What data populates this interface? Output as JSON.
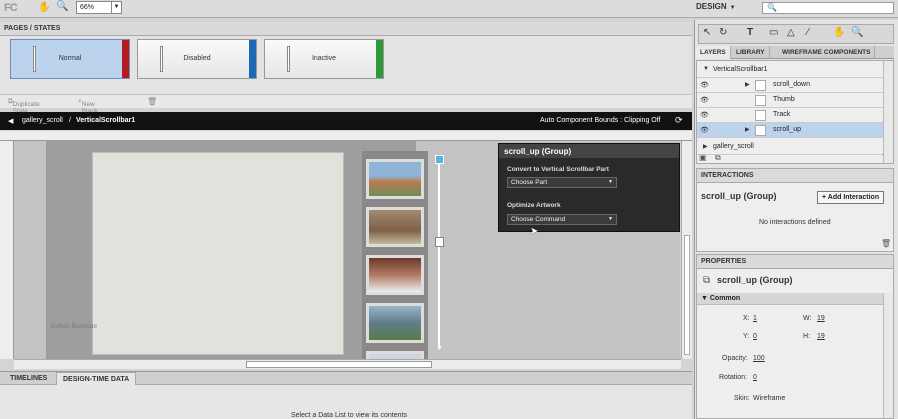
{
  "toolbar": {
    "logo": "FC",
    "zoom_value": "66%",
    "mode": "DESIGN",
    "hand_icon": "hand-icon",
    "zoom_icon": "magnifier-icon",
    "search_icon": "magnifier-icon"
  },
  "pages_states": {
    "header": "PAGES / STATES",
    "states": [
      {
        "label": "Normal",
        "color": "#b3191f"
      },
      {
        "label": "Disabled",
        "color": "#1e69b5"
      },
      {
        "label": "Inactive",
        "color": "#2f9a35"
      }
    ],
    "duplicate_label": "Duplicate State",
    "new_blank_label": "New Blank State"
  },
  "breadcrumb": {
    "root": "gallery_scroll",
    "separator": "/",
    "current": "VerticalScrollbar1",
    "bounds_label": "Auto Component Bounds : Clipping Off"
  },
  "canvas": {
    "credit": "Siebolt Bozeman"
  },
  "popup": {
    "title": "scroll_up (Group)",
    "convert_label": "Convert to Vertical Scrollbar Part",
    "choose_part": "Choose Part",
    "optimize_label": "Optimize Artwork",
    "choose_command": "Choose Command"
  },
  "bottom": {
    "tabs": [
      "TIMELINES",
      "DESIGN-TIME DATA"
    ],
    "message": "Select a Data List to view its contents"
  },
  "layers_panel": {
    "tabs": [
      "LAYERS",
      "LIBRARY",
      "WIREFRAME COMPONENTS"
    ],
    "group": "VerticalScrollbar1",
    "items": [
      "scroll_down",
      "Thumb",
      "Track",
      "scroll_up"
    ],
    "sibling": "gallery_scroll"
  },
  "interactions": {
    "header": "INTERACTIONS",
    "title": "scroll_up (Group)",
    "add_label": "+ Add Interaction",
    "empty": "No interactions defined"
  },
  "properties": {
    "header": "PROPERTIES",
    "title": "scroll_up (Group)",
    "section": "Common",
    "x_label": "X:",
    "x": "1",
    "w_label": "W:",
    "w": "19",
    "y_label": "Y:",
    "y": "0",
    "h_label": "H:",
    "h": "19",
    "opacity_label": "Opacity:",
    "opacity": "100",
    "rotation_label": "Rotation:",
    "rotation": "0",
    "skin_label": "Skin:",
    "skin": "Wireframe"
  }
}
